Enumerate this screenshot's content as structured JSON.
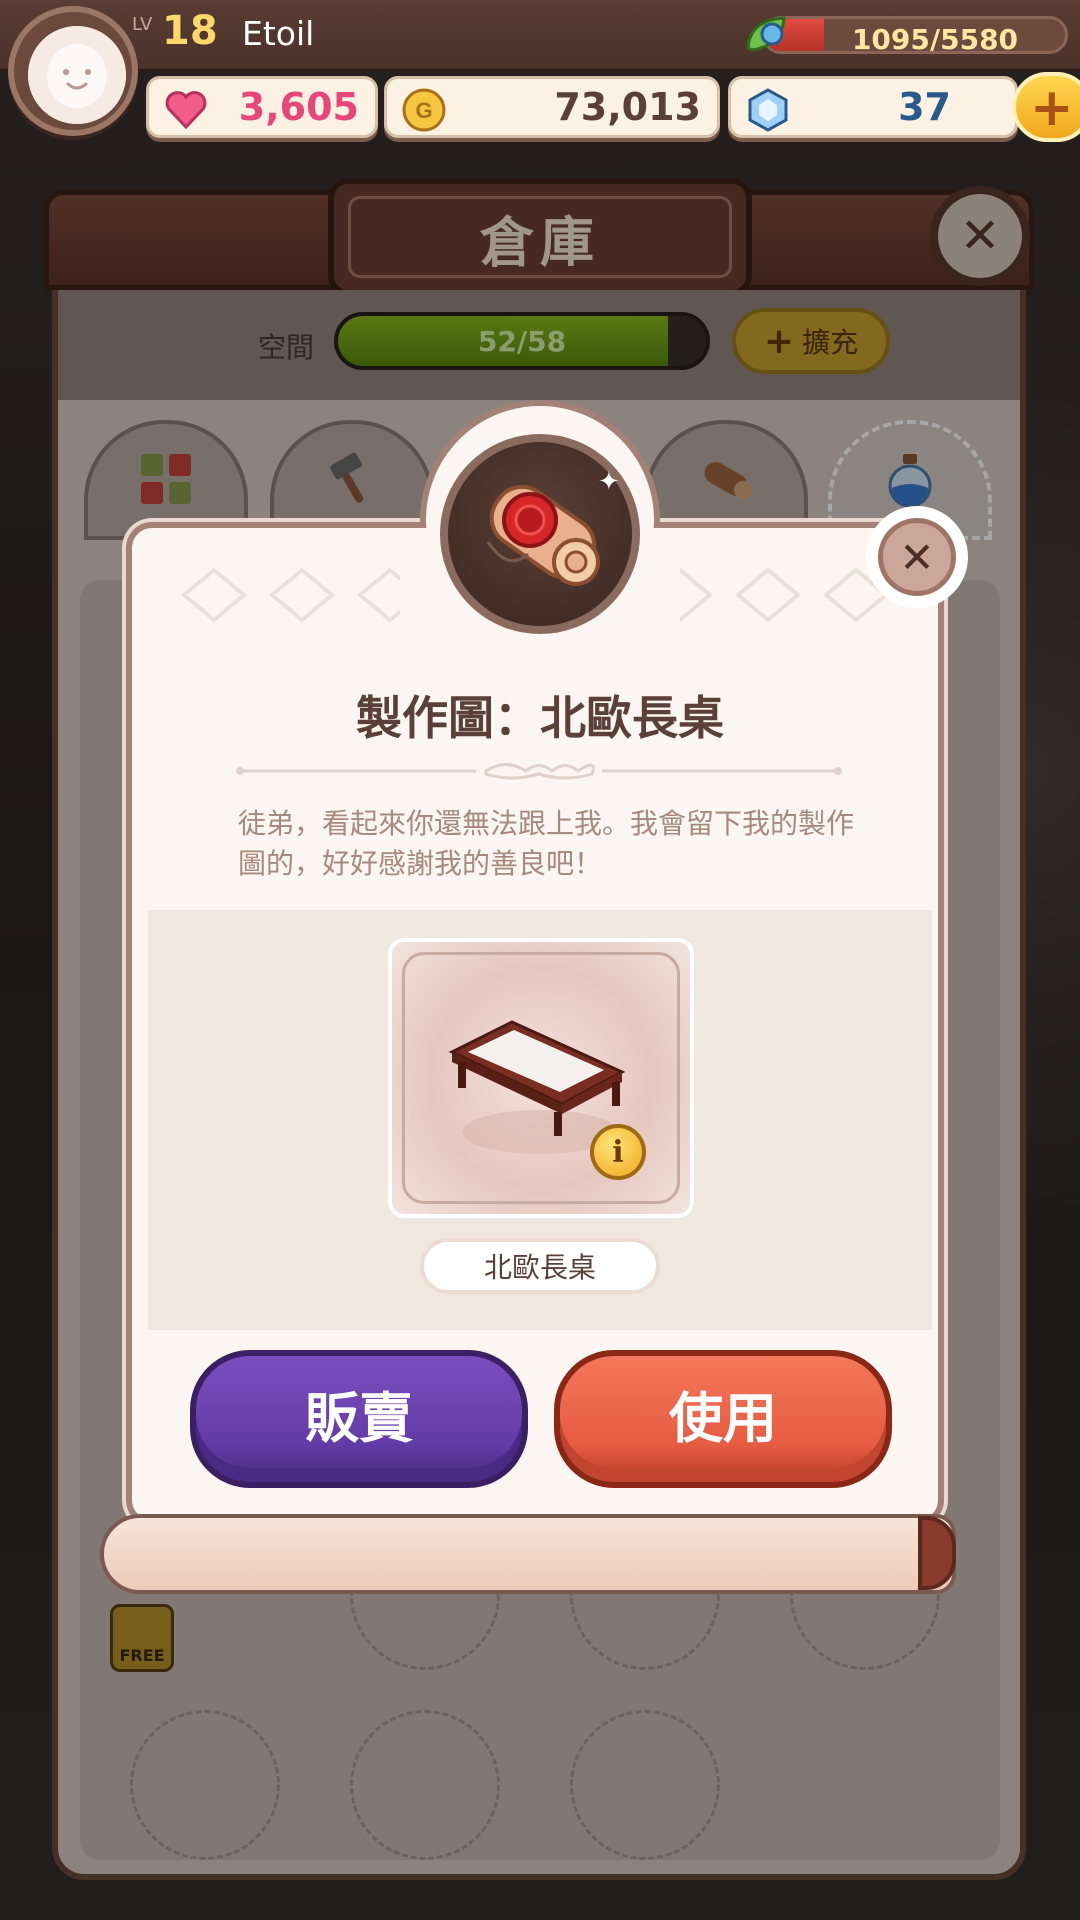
{
  "player": {
    "level_label": "LV",
    "level": "18",
    "name": "Etoil",
    "exp": {
      "current": 1095,
      "max": 5580,
      "text": "1095/5580"
    }
  },
  "resources": {
    "hearts": "3,605",
    "gold": "73,013",
    "gems": "37"
  },
  "storage": {
    "title": "倉庫",
    "capacity_label": "空間",
    "capacity": {
      "used": 52,
      "max": 58,
      "text": "52/58"
    },
    "expand_label": "擴充",
    "tabs": [
      {
        "icon": "grid-icon",
        "active": false
      },
      {
        "icon": "hammer-icon",
        "active": false
      },
      {
        "icon": "log-icon",
        "active": false
      },
      {
        "icon": "potion-icon",
        "active": true
      }
    ],
    "free_badge": "FREE"
  },
  "dialog": {
    "title": "製作圖：北歐長桌",
    "description": "徒弟，看起來你還無法跟上我。我會留下我的製作圖的，好好感謝我的善良吧！",
    "item_name": "北歐長桌",
    "sell_label": "販賣",
    "use_label": "使用",
    "header_icon": "blueprint-scroll-icon",
    "item_icon": "nordic-table-icon"
  },
  "colors": {
    "heart": "#e8467a",
    "gold": "#5a4038",
    "gem": "#2a5a8c",
    "sell_button": "#633ba6",
    "use_button": "#e65c43"
  }
}
